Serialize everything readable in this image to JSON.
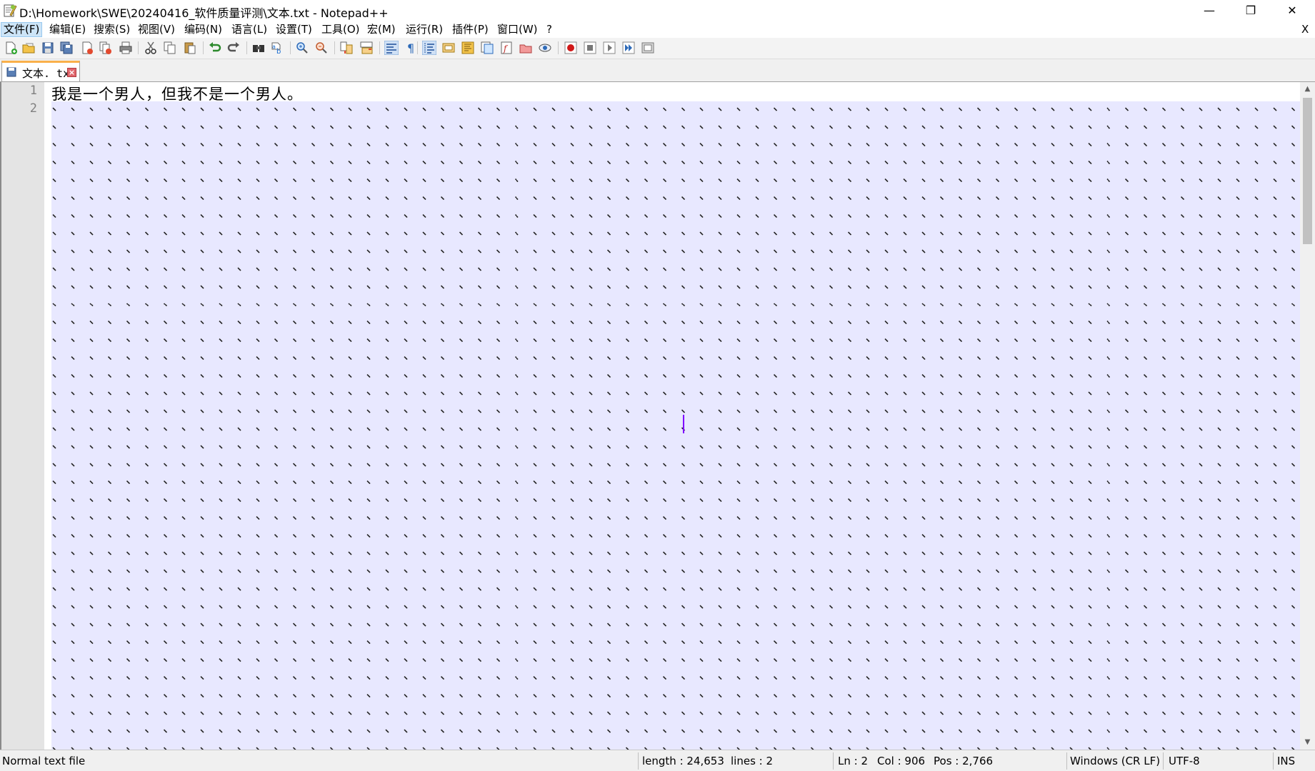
{
  "window": {
    "title": "D:\\Homework\\SWE\\20240416_软件质量评测\\文本.txt - Notepad++",
    "minimize_glyph": "—",
    "restore_glyph": "❐",
    "close_glyph": "✕"
  },
  "menu": {
    "items": [
      "文件(F)",
      "编辑(E)",
      "搜索(S)",
      "视图(V)",
      "编码(N)",
      "语言(L)",
      "设置(T)",
      "工具(O)",
      "宏(M)",
      "运行(R)",
      "插件(P)",
      "窗口(W)",
      "?"
    ],
    "active_index": 0,
    "close_label": "X"
  },
  "tabs": [
    {
      "label": "文本. txt",
      "close_glyph": "×"
    }
  ],
  "editor": {
    "line_numbers": [
      "1",
      "2"
    ],
    "line1": "我是一个男人，但我不是一个男人。",
    "current_line_color": "#e8e8ff",
    "caret_color": "#8000ff"
  },
  "status": {
    "file_type": "Normal text file",
    "length": "length : 24,653",
    "lines": "lines : 2",
    "ln": "Ln : 2",
    "col": "Col : 906",
    "pos": "Pos : 2,766",
    "eol": "Windows (CR LF)",
    "encoding": "UTF-8",
    "mode": "INS"
  },
  "toolbar_icons": [
    "new-file-icon",
    "open-file-icon",
    "save-icon",
    "save-all-icon",
    "close-icon",
    "close-all-icon",
    "print-icon",
    "cut-icon",
    "copy-icon",
    "paste-icon",
    "undo-icon",
    "redo-icon",
    "find-icon",
    "replace-icon",
    "zoom-in-icon",
    "zoom-out-icon",
    "sync-vertical-icon",
    "sync-horizontal-icon",
    "word-wrap-icon",
    "show-all-chars-icon",
    "indent-guide-icon",
    "language-udl-icon",
    "doc-map-icon",
    "doc-list-icon",
    "function-list-icon",
    "folder-workspace-icon",
    "monitoring-icon",
    "macro-record-icon",
    "macro-stop-icon",
    "macro-play-icon",
    "macro-run-multiple-icon",
    "macro-save-icon"
  ]
}
